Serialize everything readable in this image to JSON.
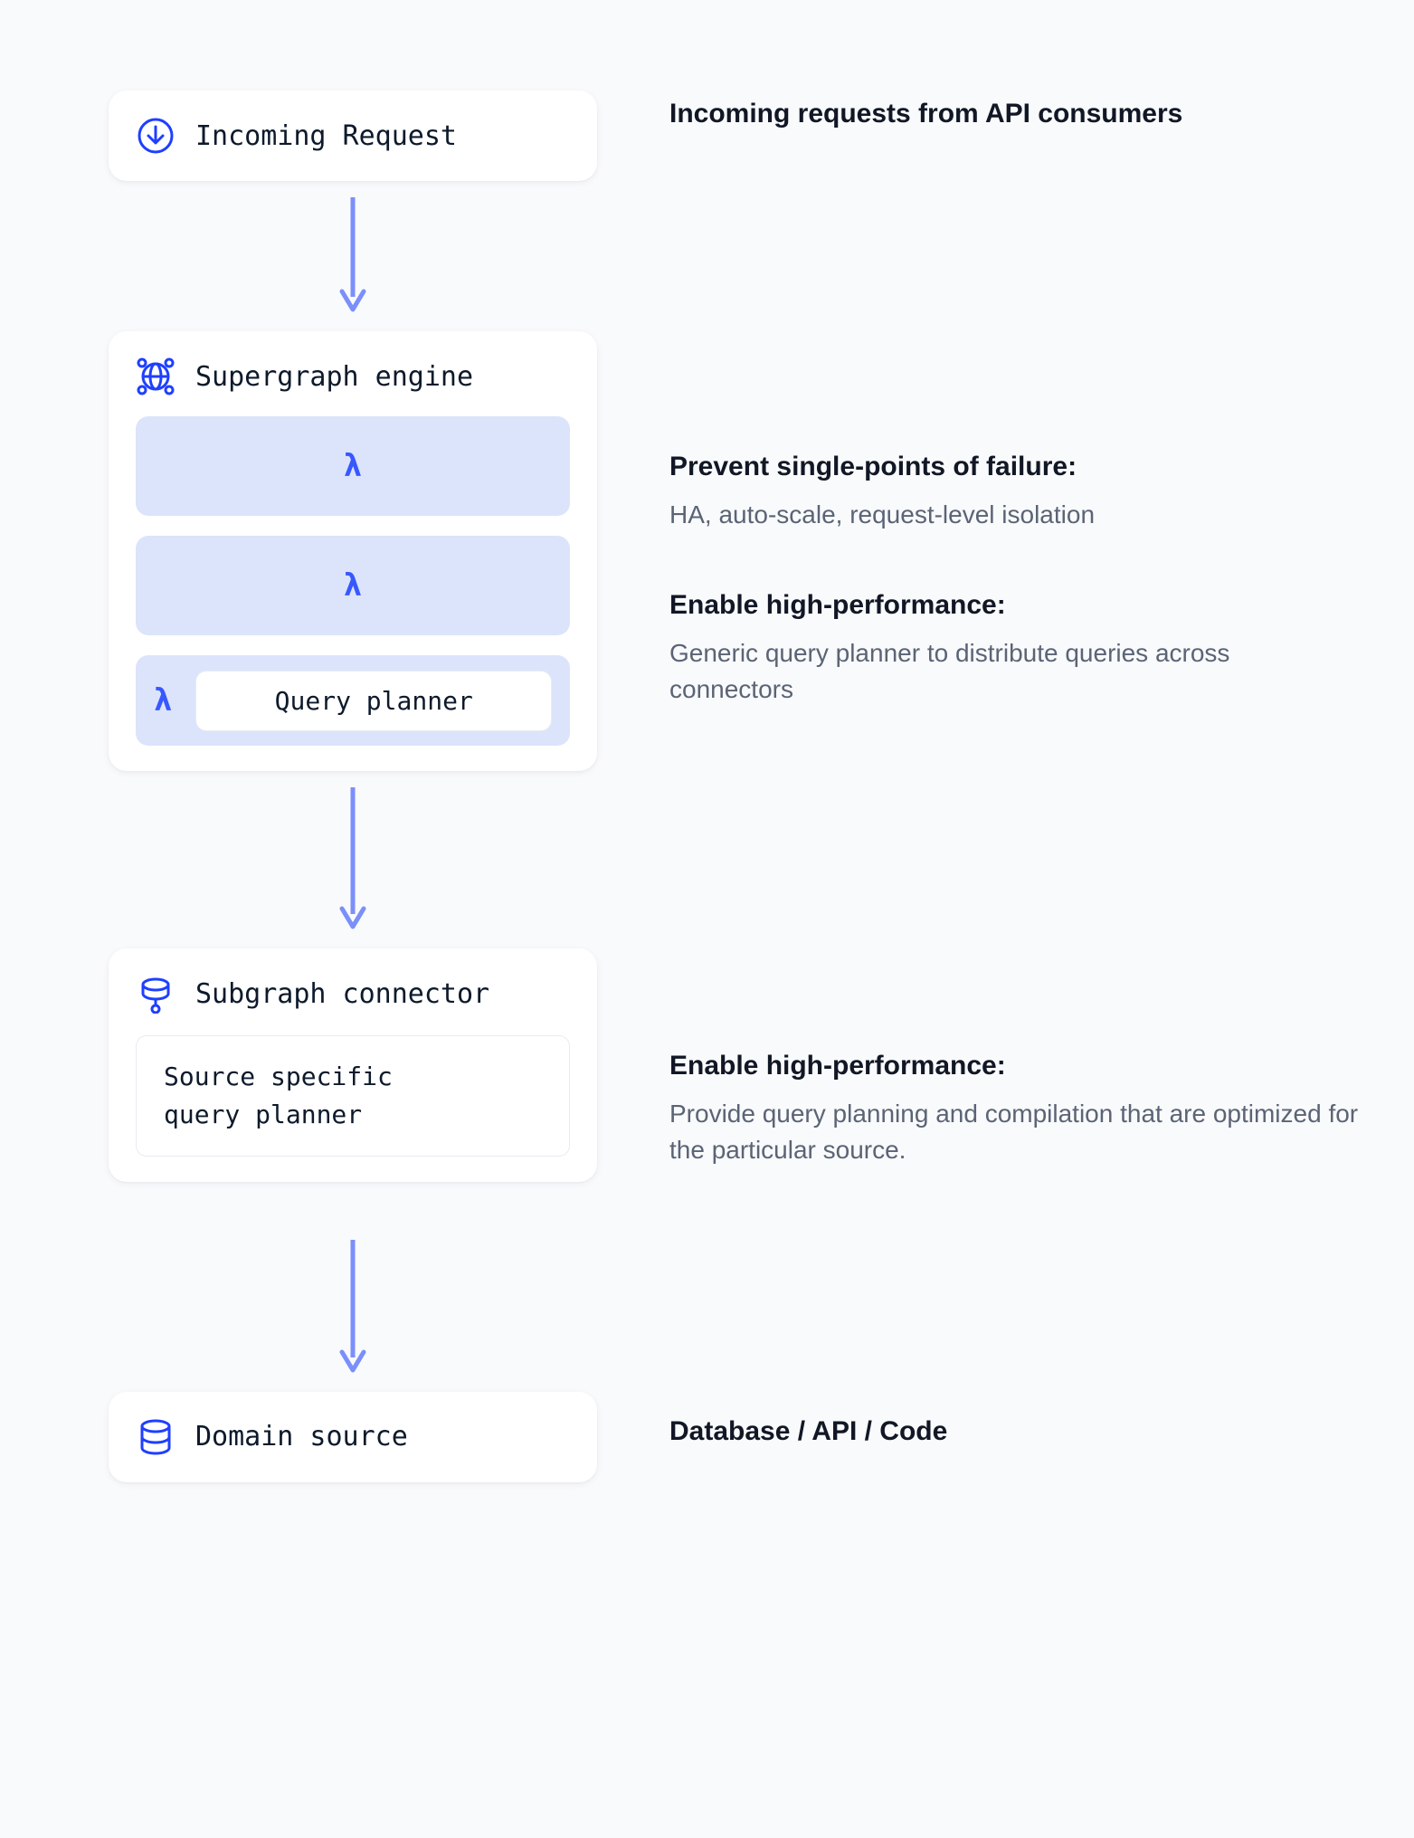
{
  "nodes": {
    "incoming": {
      "label": "Incoming Request"
    },
    "engine": {
      "label": "Supergraph engine",
      "query_planner_label": "Query planner"
    },
    "connector": {
      "label": "Subgraph connector",
      "box_label": "Source specific\nquery planner"
    },
    "domain": {
      "label": "Domain source"
    }
  },
  "descriptions": {
    "incoming": {
      "heading": "Incoming requests from API consumers"
    },
    "engine_spof": {
      "heading": "Prevent single-points of failure:",
      "body": "HA, auto-scale, request-level isolation"
    },
    "engine_perf": {
      "heading": "Enable high-performance:",
      "body": "Generic query planner to distribute queries across connectors"
    },
    "connector_perf": {
      "heading": "Enable high-performance:",
      "body": "Provide query planning and compilation that are optimized for the particular source."
    },
    "domain": {
      "heading": "Database / API / Code"
    }
  },
  "colors": {
    "accent": "#1f3fff",
    "arrow": "#7b8ffb"
  }
}
